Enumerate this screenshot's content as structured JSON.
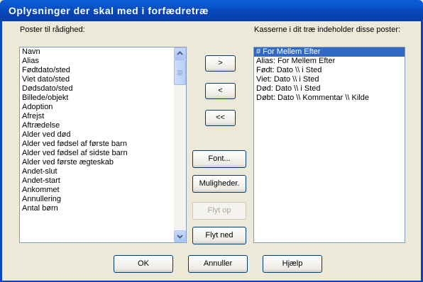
{
  "window": {
    "title": "Oplysninger der skal med i forfædretræ"
  },
  "available": {
    "label": "Poster til rådighed:",
    "items": [
      "Navn",
      "Alias",
      "Fødtdato/sted",
      "Viet dato/sted",
      "Dødsdato/sted",
      "Billede/objekt",
      "Adoption",
      "Afrejst",
      "Aftrædelse",
      "Alder ved død",
      "Alder ved fødsel af første barn",
      "Alder ved fødsel af sidste barn",
      "Alder ved første ægteskab",
      "Andet-slut",
      "Andet-start",
      "Ankommet",
      "Annullering",
      "Antal børn"
    ]
  },
  "selected": {
    "label": "Kasserne i dit træ indeholder disse poster:",
    "items": [
      "# For Mellem Efter",
      "Alias: For Mellem Efter",
      "Født: Dato \\\\ i Sted",
      "Viet: Dato \\\\ i Sted",
      "Død: Dato \\\\ i Sted",
      "Døbt: Dato \\\\ Kommentar \\\\ Kilde"
    ],
    "selected_index": 0
  },
  "buttons": {
    "add": ">",
    "remove": "<",
    "remove_all": "<<",
    "font": "Font...",
    "options": "Muligheder.",
    "move_up": "Flyt op",
    "move_down": "Flyt ned",
    "ok": "OK",
    "cancel": "Annuller",
    "help": "Hjælp"
  }
}
